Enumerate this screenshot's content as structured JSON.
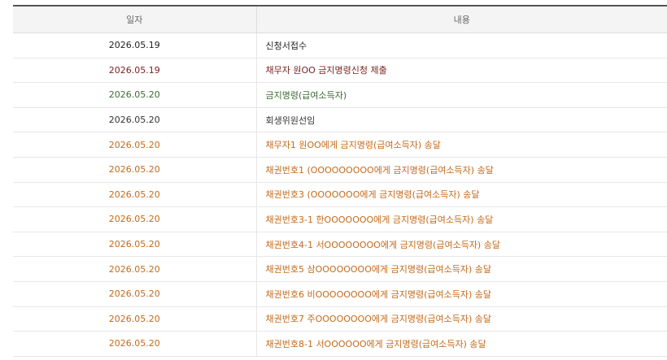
{
  "table": {
    "headers": {
      "date": "일자",
      "content": "내용"
    },
    "rows": [
      {
        "date": "2026.05.19",
        "content": "신청서접수",
        "color": "#222222"
      },
      {
        "date": "2026.05.19",
        "content": "채무자 원OO 금지명령신청 제출",
        "color": "#7a1f1f"
      },
      {
        "date": "2026.05.20",
        "content": "금지명령(급여소득자)",
        "color": "#3b6b33"
      },
      {
        "date": "2026.05.20",
        "content": "회생위원선임",
        "color": "#333333"
      },
      {
        "date": "2026.05.20",
        "content": "채무자1 원OO에게 금지명령(급여소득자) 송달",
        "color": "#c46a1a"
      },
      {
        "date": "2026.05.20",
        "content": "채권번호1 (OOOOOOOOO에게 금지명령(급여소득자) 송달",
        "color": "#c46a1a"
      },
      {
        "date": "2026.05.20",
        "content": "채권번호3 (OOOOOOO에게 금지명령(급여소득자) 송달",
        "color": "#c46a1a"
      },
      {
        "date": "2026.05.20",
        "content": "채권번호3-1 한OOOOOOO에게 금지명령(급여소득자) 송달",
        "color": "#c46a1a"
      },
      {
        "date": "2026.05.20",
        "content": "채권번호4-1 서OOOOOOOO에게 금지명령(급여소득자) 송달",
        "color": "#c46a1a"
      },
      {
        "date": "2026.05.20",
        "content": "채권번호5 삼OOOOOOOO에게 금지명령(급여소득자) 송달",
        "color": "#c46a1a"
      },
      {
        "date": "2026.05.20",
        "content": "채권번호6 비OOOOOOOO에게 금지명령(급여소득자) 송달",
        "color": "#c46a1a"
      },
      {
        "date": "2026.05.20",
        "content": "채권번호7 주OOOOOOOO에게 금지명령(급여소득자) 송달",
        "color": "#c46a1a"
      },
      {
        "date": "2026.05.20",
        "content": "채권번호8-1 서OOOOOO에게 금지명령(급여소득자) 송달",
        "color": "#c46a1a"
      }
    ]
  }
}
